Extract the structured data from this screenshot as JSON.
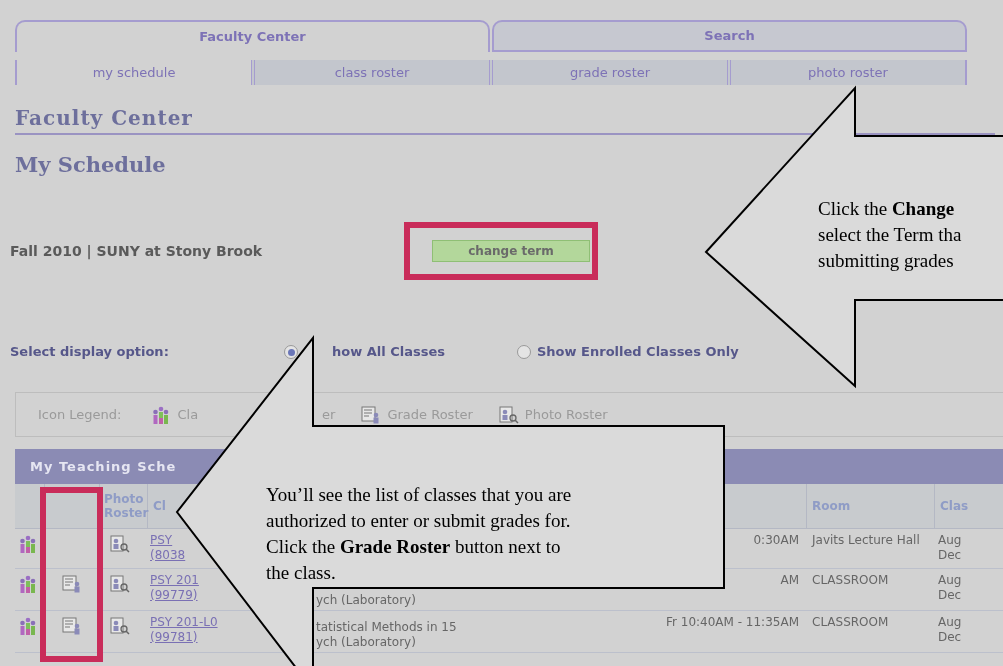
{
  "tabs": [
    {
      "label": "Faculty Center",
      "selected": true
    },
    {
      "label": "Search",
      "selected": false
    }
  ],
  "subtabs": [
    {
      "label": "my schedule",
      "selected": true
    },
    {
      "label": "class roster",
      "selected": false
    },
    {
      "label": "grade roster",
      "selected": false
    },
    {
      "label": "photo roster",
      "selected": false
    }
  ],
  "heading": "Faculty Center",
  "page_title": "My Schedule",
  "term": "Fall 2010 | SUNY at Stony Brook",
  "change_term_button": "change term",
  "display_option": {
    "label": "Select display option:",
    "options": [
      {
        "label": "how All Classes",
        "selected": true
      },
      {
        "label": "Show Enrolled Classes Only",
        "selected": false
      }
    ]
  },
  "icon_legend": {
    "label": "Icon Legend:",
    "items": [
      {
        "kind": "class",
        "label": "Cla",
        "tail": "er"
      },
      {
        "kind": "grade",
        "label": "Grade Roster"
      },
      {
        "kind": "photo",
        "label": "Photo Roster"
      }
    ]
  },
  "schedule": {
    "title": "My Teaching Sche",
    "columns": {
      "photo": "Photo Roster",
      "class": "Cl",
      "room": "Room",
      "column_8": "Clas"
    },
    "rows": [
      {
        "grade_roster": false,
        "class": [
          "PSY",
          "(8038"
        ],
        "time": "0:30AM",
        "room": "Javits Lecture Hall",
        "dates": [
          "Aug",
          "Dec"
        ]
      },
      {
        "grade_roster": true,
        "class": [
          "PSY 201",
          "(99779)"
        ],
        "description": [
          "ych (Laboratory)"
        ],
        "time": "AM",
        "room": "CLASSROOM",
        "dates": [
          "Aug",
          "Dec"
        ]
      },
      {
        "grade_roster": true,
        "class": [
          "PSY 201-L0",
          "(99781)"
        ],
        "description": [
          "tatistical Methods in 15",
          "ych (Laboratory)"
        ],
        "time": "Fr 10:40AM - 11:35AM",
        "room": "CLASSROOM",
        "dates": [
          "Aug",
          "Dec"
        ]
      }
    ]
  },
  "callouts": [
    {
      "lines": [
        "Click the **Change**",
        "select the Term tha",
        "submitting grades"
      ]
    },
    {
      "lines": [
        "You’ll see the list of classes that you are",
        "authorized to enter or submit grades for.",
        "Click the **Grade Roster** button next to",
        "the class."
      ]
    }
  ]
}
